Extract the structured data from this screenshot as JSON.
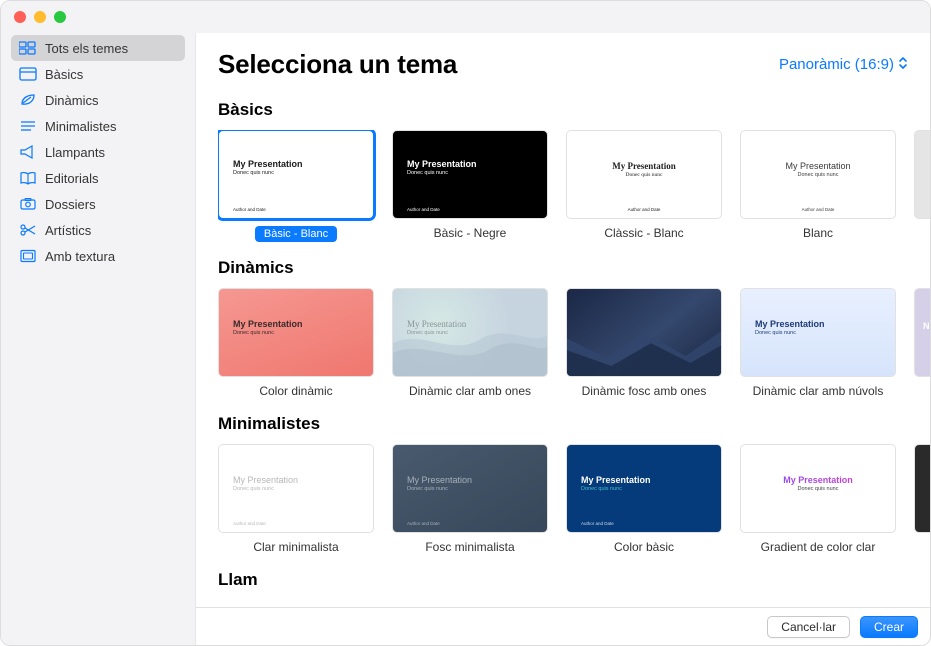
{
  "header": {
    "title": "Selecciona un tema",
    "aspectLabel": "Panoràmic (16:9)"
  },
  "sidebar": {
    "items": [
      {
        "label": "Tots els temes",
        "icon": "grid"
      },
      {
        "label": "Bàsics",
        "icon": "layout"
      },
      {
        "label": "Dinàmics",
        "icon": "leaf"
      },
      {
        "label": "Minimalistes",
        "icon": "lines"
      },
      {
        "label": "Llampants",
        "icon": "megaphone"
      },
      {
        "label": "Editorials",
        "icon": "book"
      },
      {
        "label": "Dossiers",
        "icon": "camera"
      },
      {
        "label": "Artístics",
        "icon": "scissors"
      },
      {
        "label": "Amb textura",
        "icon": "frame"
      }
    ]
  },
  "sections": [
    {
      "title": "Bàsics",
      "themes": [
        {
          "label": "Bàsic - Blanc"
        },
        {
          "label": "Bàsic - Negre"
        },
        {
          "label": "Clàssic - Blanc"
        },
        {
          "label": "Blanc"
        }
      ]
    },
    {
      "title": "Dinàmics",
      "themes": [
        {
          "label": "Color dinàmic"
        },
        {
          "label": "Dinàmic clar amb ones"
        },
        {
          "label": "Dinàmic fosc amb ones"
        },
        {
          "label": "Dinàmic clar amb núvols"
        }
      ]
    },
    {
      "title": "Minimalistes",
      "themes": [
        {
          "label": "Clar minimalista"
        },
        {
          "label": "Fosc minimalista"
        },
        {
          "label": "Color bàsic"
        },
        {
          "label": "Gradient de color clar"
        }
      ]
    },
    {
      "title": "Llam",
      "themes": []
    }
  ],
  "thumbText": {
    "heading": "My Presentation",
    "sub": "Donec quis nunc",
    "footer": "Author and Date"
  },
  "footer": {
    "cancel": "Cancel·lar",
    "create": "Crear"
  }
}
